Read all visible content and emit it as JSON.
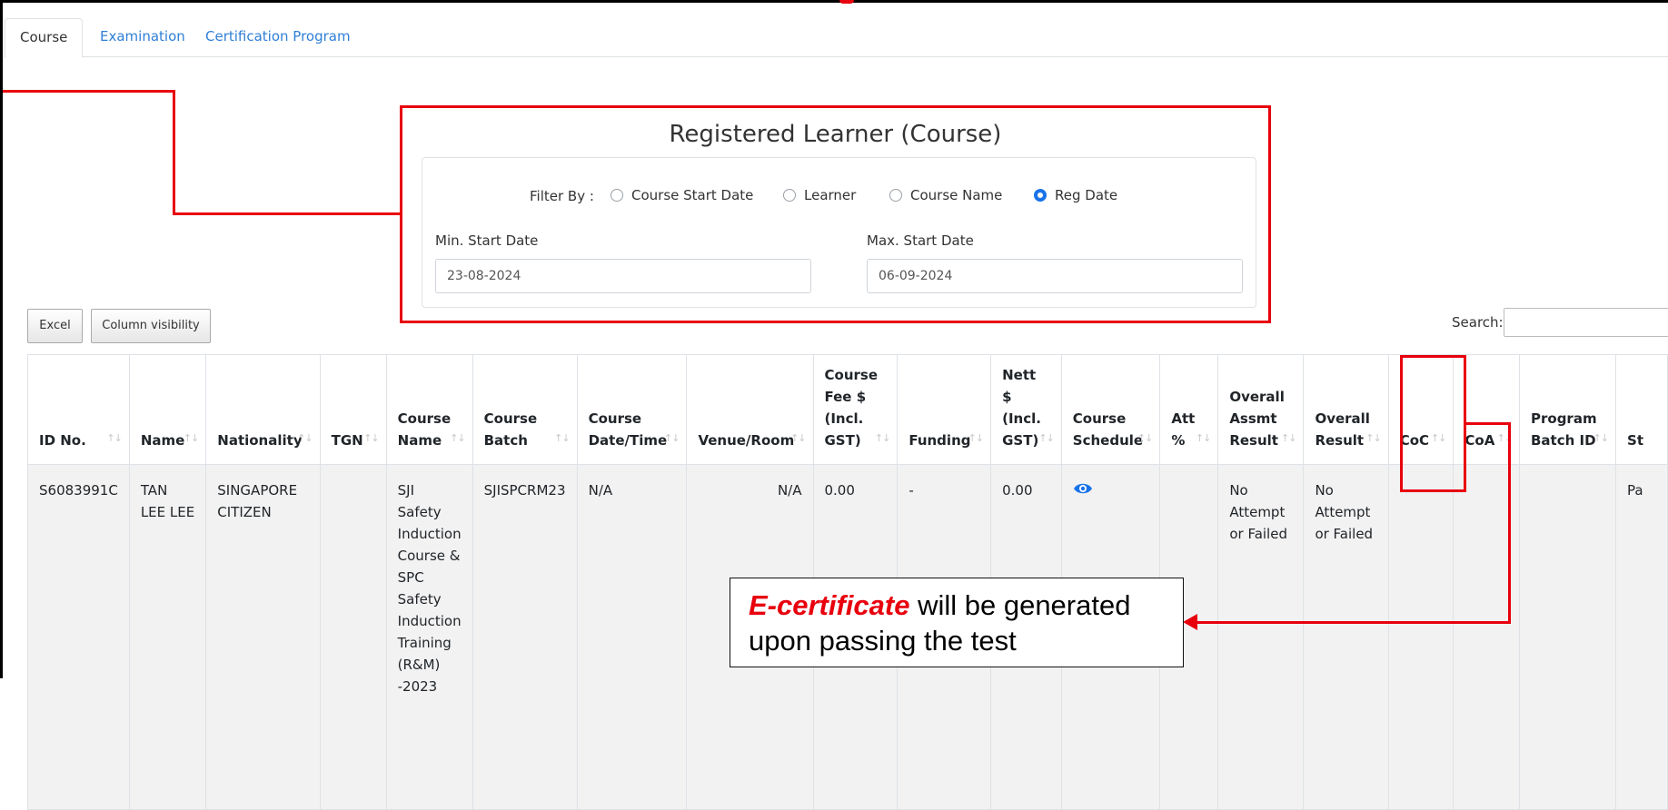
{
  "tabs": [
    {
      "label": "Course",
      "active": true
    },
    {
      "label": "Examination",
      "active": false
    },
    {
      "label": "Certification Program",
      "active": false
    }
  ],
  "filter": {
    "title": "Registered Learner (Course)",
    "filter_by_label": "Filter By :",
    "options": [
      "Course Start Date",
      "Learner",
      "Course Name",
      "Reg Date"
    ],
    "selected": "Reg Date",
    "min_label": "Min. Start Date",
    "min_value": "23-08-2024",
    "max_label": "Max. Start Date",
    "max_value": "06-09-2024"
  },
  "toolbar": {
    "excel_label": "Excel",
    "column_visibility_label": "Column visibility",
    "search_label": "Search:"
  },
  "table": {
    "headers": [
      "ID No.",
      "Name",
      "Nationality",
      "TGN",
      "Course Name",
      "Course Batch",
      "Course Date/Time",
      "Venue/Room",
      "Course Fee $ (Incl. GST)",
      "Funding",
      "Nett $ (Incl. GST)",
      "Course Schedule",
      "Att %",
      "Overall Assmt Result",
      "Overall Result",
      "CoC",
      "CoA",
      "Program Batch ID",
      "St"
    ],
    "rows": [
      [
        "S6083991C",
        "TAN LEE LEE",
        "SINGAPORE CITIZEN",
        "",
        "SJI Safety Induction Course & SPC Safety Induction Training (R&M) -2023",
        "SJISPCRM23",
        "N/A",
        "N/A",
        "0.00",
        "-",
        "0.00",
        "eye-icon",
        "",
        "No Attempt or Failed",
        "No Attempt or Failed",
        "",
        "",
        "",
        "Pa"
      ]
    ]
  },
  "callout": {
    "emphasis": "E-certificate",
    "text": " will be generated upon passing the test"
  },
  "colors": {
    "annotation_red": "#e8000d",
    "link_blue": "#2f7fd6",
    "radio_blue": "#1a73e8"
  }
}
